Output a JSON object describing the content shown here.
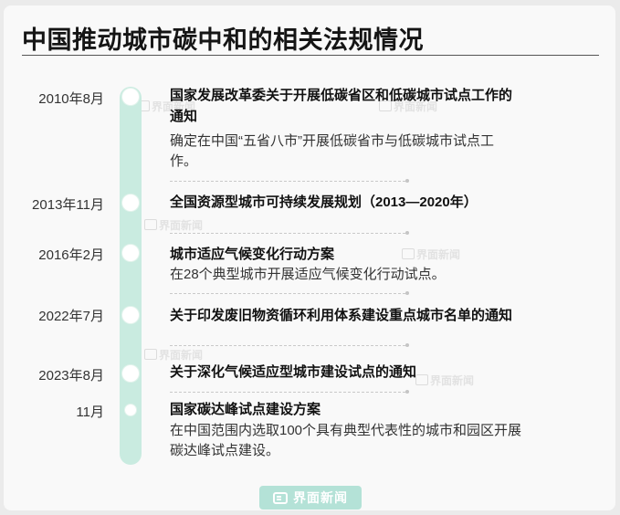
{
  "title": "中国推动城市碳中和的相关法规情况",
  "watermark": "界面新闻",
  "logo_text": "界面新闻",
  "entries": [
    {
      "date": "2010年8月",
      "title_lines": [
        "国家发展改革委关于开展低碳省区和低碳城市试点工作的",
        "通知"
      ],
      "desc_lines": [
        "确定在中国“五省八市”开展低碳省市与低碳城市试点工",
        "作。"
      ]
    },
    {
      "date": "2013年11月",
      "title_lines": [
        "全国资源型城市可持续发展规划（2013—2020年）"
      ],
      "desc_lines": []
    },
    {
      "date": "2016年2月",
      "title_lines": [
        "城市适应气候变化行动方案"
      ],
      "desc_lines": [
        "在28个典型城市开展适应气候变化行动试点。"
      ]
    },
    {
      "date": "2022年7月",
      "title_lines": [
        "关于印发废旧物资循环利用体系建设重点城市名单的通知"
      ],
      "desc_lines": []
    },
    {
      "date": "2023年8月",
      "title_lines": [
        "关于深化气候适应型城市建设试点的通知"
      ],
      "desc_lines": []
    },
    {
      "date": "11月",
      "title_lines": [
        "国家碳达峰试点建设方案"
      ],
      "desc_lines": [
        "在中国范围内选取100个具有典型代表性的城市和园区开展",
        "碳达峰试点建设。"
      ]
    }
  ]
}
